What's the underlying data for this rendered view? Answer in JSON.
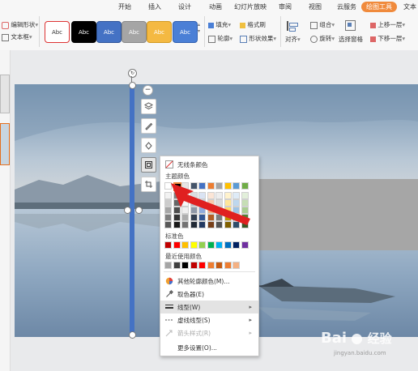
{
  "ribbon": {
    "tabs": [
      {
        "label": "开始",
        "active": false
      },
      {
        "label": "插入",
        "active": false
      },
      {
        "label": "设计",
        "active": false
      },
      {
        "label": "动画",
        "active": false
      },
      {
        "label": "幻灯片放映",
        "active": false
      },
      {
        "label": "审阅",
        "active": false
      },
      {
        "label": "视图",
        "active": false
      },
      {
        "label": "云服务",
        "active": false
      },
      {
        "label": "绘图工具",
        "active": true
      },
      {
        "label": "文本",
        "active": false
      }
    ],
    "left_tools": {
      "edit_shape": "编辑形状",
      "text_box": "文本框"
    },
    "style_swatches": [
      "Abc",
      "Abc",
      "Abc",
      "Abc",
      "Abc",
      "Abc"
    ],
    "fill": "填充",
    "format_brush": "格式刷",
    "outline": "轮廓",
    "shape_effect": "形状效果",
    "align": "对齐",
    "combine": "组合",
    "rotate": "旋转",
    "select_pane": "选择窗格",
    "bring_forward": "上移一层",
    "send_backward": "下移一层"
  },
  "menu": {
    "no_line": "无线条颜色",
    "theme_colors_title": "主题颜色",
    "standard_colors_title": "标准色",
    "recent_colors_title": "最近使用颜色",
    "more_colors": "其他轮廓颜色(M)...",
    "eyedropper": "取色器(E)",
    "line_type": "线型(W)",
    "dash_type": "虚线线型(S)",
    "arrow_style": "箭头样式(R)",
    "more_settings": "更多设置(O)...",
    "theme_top": [
      "#ffffff",
      "#000000",
      "#e7e6e6",
      "#44546a",
      "#4472c4",
      "#ed7d31",
      "#a5a5a5",
      "#ffc000",
      "#5b9bd5",
      "#70ad47"
    ],
    "standard": [
      "#c00000",
      "#ff0000",
      "#ffc000",
      "#ffff00",
      "#92d050",
      "#00b050",
      "#00b0f0",
      "#0070c0",
      "#002060",
      "#7030a0"
    ],
    "recent": [
      "#a5a5a5",
      "#404040",
      "#000000",
      "#c00000",
      "#ff0000",
      "#ed7d31",
      "#c55a11",
      "#ed7d31",
      "#f4b183"
    ]
  },
  "watermark": {
    "brand": "Bai",
    "logo_text": "经验",
    "url": "jingyan.baidu.com"
  },
  "colors": {
    "accent": "#f08a3c",
    "line": "#4472c4",
    "arrow": "#e02020"
  }
}
